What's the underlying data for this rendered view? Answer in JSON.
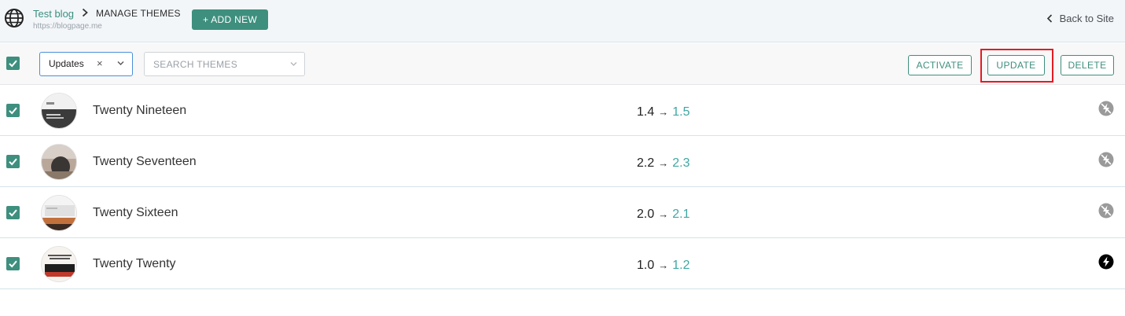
{
  "header": {
    "site_name": "Test blog",
    "page_title": "MANAGE THEMES",
    "site_url": "https://blogpage.me",
    "add_new_label": "+ ADD NEW",
    "back_label": "Back to Site",
    "icons": {
      "site": "globe-icon",
      "separator": "chevron-right-icon",
      "back": "chevron-left-icon"
    }
  },
  "toolbar": {
    "select_all_checked": true,
    "filter_value": "Updates",
    "filter_clear": "×",
    "search_placeholder": "SEARCH THEMES",
    "activate_label": "ACTIVATE",
    "update_label": "UPDATE",
    "delete_label": "DELETE",
    "highlighted_button": "update",
    "highlight_color": "#e31b23"
  },
  "themes": [
    {
      "name": "Twenty Nineteen",
      "current": "1.4",
      "new": "1.5",
      "checked": true,
      "status_icon": "lightning-off-icon",
      "active": false
    },
    {
      "name": "Twenty Seventeen",
      "current": "2.2",
      "new": "2.3",
      "checked": true,
      "status_icon": "lightning-off-icon",
      "active": false
    },
    {
      "name": "Twenty Sixteen",
      "current": "2.0",
      "new": "2.1",
      "checked": true,
      "status_icon": "lightning-off-icon",
      "active": false
    },
    {
      "name": "Twenty Twenty",
      "current": "1.0",
      "new": "1.2",
      "checked": true,
      "status_icon": "lightning-icon",
      "active": true
    }
  ],
  "colors": {
    "accent": "#3e8f7e",
    "new_version": "#3fa7a3",
    "focus": "#4a90d9"
  }
}
